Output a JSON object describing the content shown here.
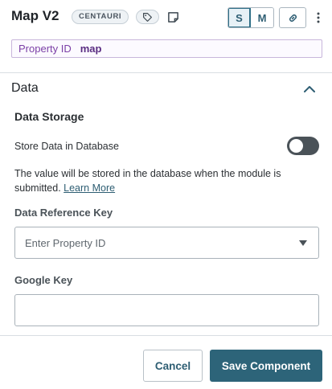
{
  "header": {
    "title": "Map V2",
    "badge": "CENTAURI",
    "size_options": [
      "S",
      "M"
    ],
    "selected_size": "S"
  },
  "property_id": {
    "label": "Property ID",
    "value": "map"
  },
  "section": {
    "title": "Data",
    "expanded": true
  },
  "data_storage": {
    "title": "Data Storage",
    "toggle_label": "Store Data in Database",
    "toggle_on": false,
    "help_text": "The value will be stored in the database when the module is submitted.",
    "help_link": "Learn More"
  },
  "data_reference_key": {
    "label": "Data Reference Key",
    "placeholder": "Enter Property ID"
  },
  "google_key": {
    "label": "Google Key",
    "value": ""
  },
  "footer": {
    "cancel_label": "Cancel",
    "save_label": "Save Component"
  },
  "colors": {
    "primary": "#2d6479",
    "property_accent": "#7b3fa6",
    "toggle_off": "#4a5258"
  }
}
